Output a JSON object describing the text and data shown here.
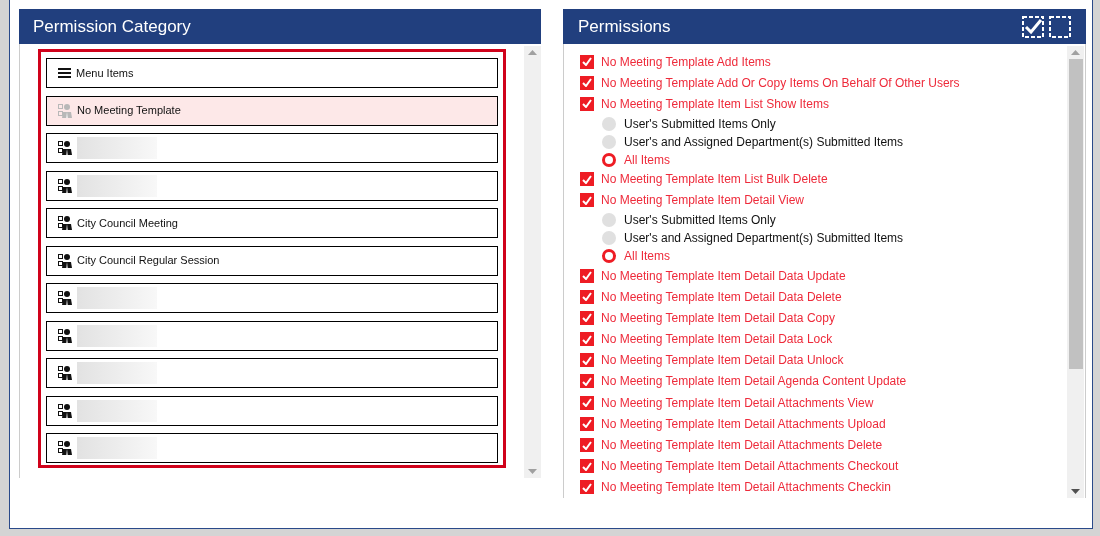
{
  "category_panel": {
    "title": "Permission Category",
    "items": [
      {
        "kind": "menu",
        "label": "Menu Items",
        "selected": false,
        "redacted": false
      },
      {
        "kind": "group",
        "label": "No Meeting Template",
        "selected": true,
        "redacted": false
      },
      {
        "kind": "group",
        "selected": false,
        "redacted": true
      },
      {
        "kind": "group",
        "selected": false,
        "redacted": true
      },
      {
        "kind": "group",
        "label": "City Council Meeting",
        "selected": false,
        "redacted": false
      },
      {
        "kind": "group",
        "label": "City Council Regular Session",
        "selected": false,
        "redacted": false
      },
      {
        "kind": "group",
        "selected": false,
        "redacted": true
      },
      {
        "kind": "group",
        "selected": false,
        "redacted": true
      },
      {
        "kind": "group",
        "selected": false,
        "redacted": true
      },
      {
        "kind": "group",
        "selected": false,
        "redacted": true
      },
      {
        "kind": "group",
        "selected": false,
        "redacted": true
      }
    ]
  },
  "permissions_panel": {
    "title": "Permissions",
    "items": [
      {
        "label": "No Meeting Template Add Items",
        "checked": true
      },
      {
        "label": "No Meeting Template Add Or Copy Items On Behalf Of Other Users",
        "checked": true
      },
      {
        "label": "No Meeting Template Item List Show Items",
        "checked": true,
        "options": [
          {
            "label": "User's Submitted Items Only",
            "selected": false
          },
          {
            "label": "User's and Assigned Department(s) Submitted Items",
            "selected": false
          },
          {
            "label": "All Items",
            "selected": true
          }
        ]
      },
      {
        "label": "No Meeting Template Item List Bulk Delete",
        "checked": true
      },
      {
        "label": "No Meeting Template Item Detail View",
        "checked": true,
        "options": [
          {
            "label": "User's Submitted Items Only",
            "selected": false
          },
          {
            "label": "User's and Assigned Department(s) Submitted Items",
            "selected": false
          },
          {
            "label": "All Items",
            "selected": true
          }
        ]
      },
      {
        "label": "No Meeting Template Item Detail Data Update",
        "checked": true
      },
      {
        "label": "No Meeting Template Item Detail Data Delete",
        "checked": true
      },
      {
        "label": "No Meeting Template Item Detail Data Copy",
        "checked": true
      },
      {
        "label": "No Meeting Template Item Detail Data Lock",
        "checked": true
      },
      {
        "label": "No Meeting Template Item Detail Data Unlock",
        "checked": true
      },
      {
        "label": "No Meeting Template Item Detail Agenda Content Update",
        "checked": true
      },
      {
        "label": "No Meeting Template Item Detail Attachments View",
        "checked": true
      },
      {
        "label": "No Meeting Template Item Detail Attachments Upload",
        "checked": true
      },
      {
        "label": "No Meeting Template Item Detail Attachments Delete",
        "checked": true
      },
      {
        "label": "No Meeting Template Item Detail Attachments Checkout",
        "checked": true
      },
      {
        "label": "No Meeting Template Item Detail Attachments Checkin",
        "checked": true
      }
    ]
  }
}
